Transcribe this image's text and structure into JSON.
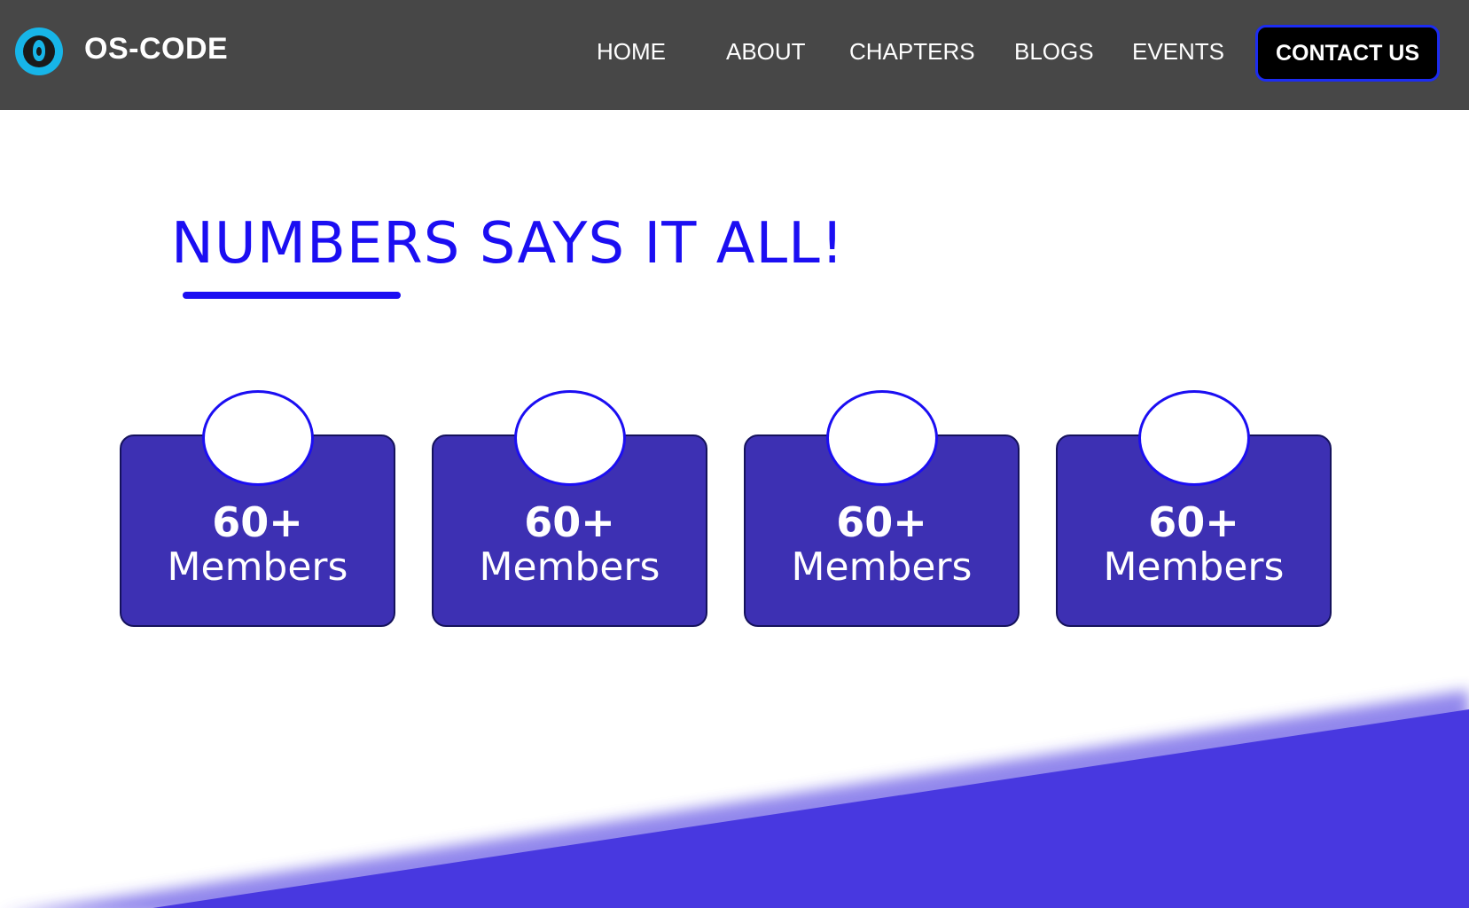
{
  "header": {
    "brand": "OS-CODE",
    "nav": [
      "HOME",
      "ABOUT",
      "CHAPTERS",
      "BLOGS",
      "EVENTS"
    ],
    "cta_label": "CONTACT US"
  },
  "section": {
    "title": "NUMBERS SAYS IT ALL!"
  },
  "stats": [
    {
      "value": "60+",
      "label": "Members"
    },
    {
      "value": "60+",
      "label": "Members"
    },
    {
      "value": "60+",
      "label": "Members"
    },
    {
      "value": "60+",
      "label": "Members"
    }
  ],
  "colors": {
    "navbar": "#474747",
    "accent": "#1b0ef2",
    "card": "#3d30b3",
    "logo": "#17b5e8",
    "wave": "#4838e0"
  },
  "icons": {
    "logo": "flame-logo-icon"
  }
}
